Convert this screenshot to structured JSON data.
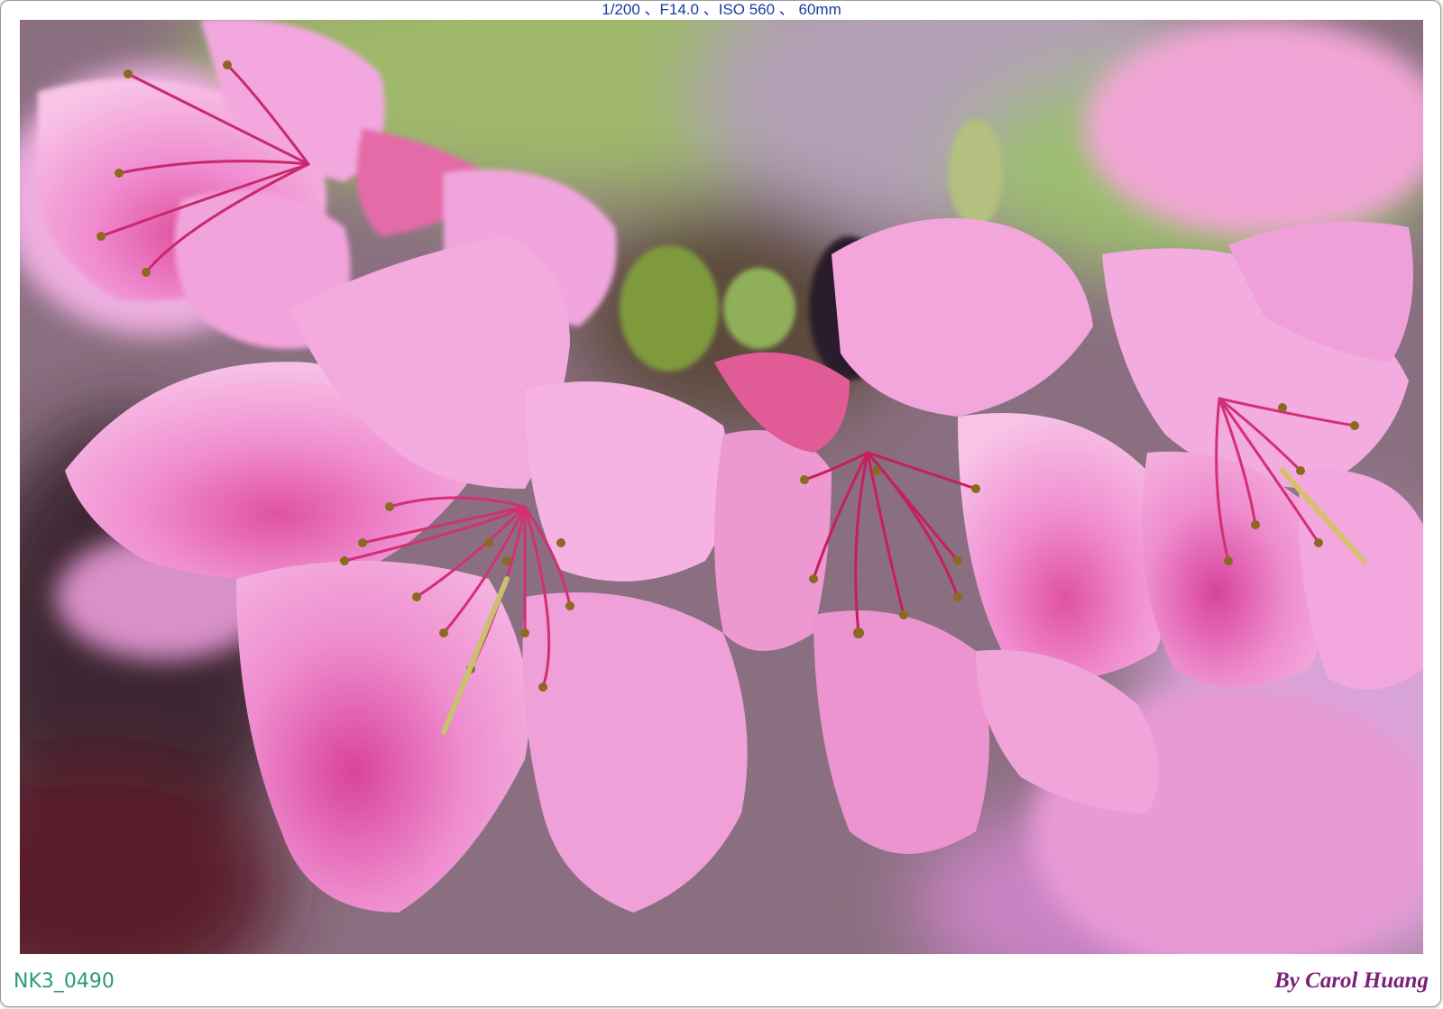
{
  "exif_caption": "1/200 、F14.0 、ISO 560 、 60mm",
  "file_id": "NK3_0490",
  "credit": "By Carol Huang",
  "colors": {
    "petal_light": "#f0a8dc",
    "petal_mid": "#e67fc6",
    "petal_deep": "#c2458c",
    "stamen": "#d8286a",
    "anther": "#8a6a20",
    "leaf": "#8fae5a",
    "background_blur": "#7a5a6a"
  }
}
